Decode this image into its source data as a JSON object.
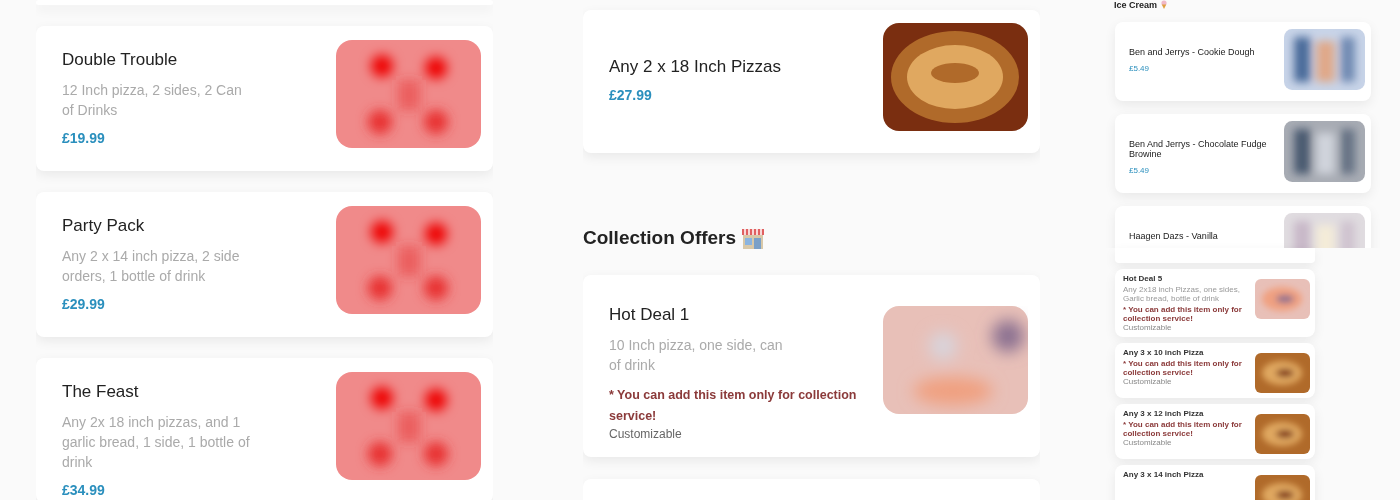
{
  "left_column": {
    "items": [
      {
        "name": "Double Trouble",
        "description": "12 Inch pizza, 2 sides, 2 Can of Drinks",
        "price": "£19.99"
      },
      {
        "name": "Party Pack",
        "description": "Any 2 x 14 inch pizza, 2 side orders, 1 bottle of drink",
        "price": "£29.99"
      },
      {
        "name": "The Feast",
        "description": "Any 2x 18 inch pizzas, and 1 garlic bread, 1 side, 1 bottle of drink",
        "price": "£34.99"
      }
    ]
  },
  "middle_column": {
    "items": [
      {
        "name": "Any 2 x 18 Inch Pizzas",
        "price": "£27.99"
      }
    ],
    "section": {
      "heading": "Collection Offers",
      "items": [
        {
          "name": "Hot Deal 1",
          "description": "10 Inch pizza, one side, can of drink",
          "notice": "* You can add this item only for collection service!",
          "tag": "Customizable"
        }
      ]
    }
  },
  "right_top": {
    "heading": "Ice Cream",
    "items": [
      {
        "name": "Ben and Jerrys - Cookie Dough",
        "price": "£5.49"
      },
      {
        "name": "Ben And Jerrys - Chocolate Fudge Browine",
        "price": "£5.49"
      },
      {
        "name": "Haagen Dazs - Vanilla"
      }
    ]
  },
  "right_bottom": {
    "items": [
      {
        "name": "Hot Deal 5",
        "description": "Any 2x18 inch Pizzas, one sides, Garlic bread, bottle of drink",
        "notice": "* You can add this item only for collection service!",
        "tag": "Customizable"
      },
      {
        "name": "Any 3 x 10 inch Pizza",
        "notice": "* You can add this item only for collection service!",
        "tag": "Customizable"
      },
      {
        "name": "Any 3 x 12 inch Pizza",
        "notice": "* You can add this item only for collection service!",
        "tag": "Customizable"
      },
      {
        "name": "Any 3 x 14 inch Pizza"
      }
    ]
  }
}
